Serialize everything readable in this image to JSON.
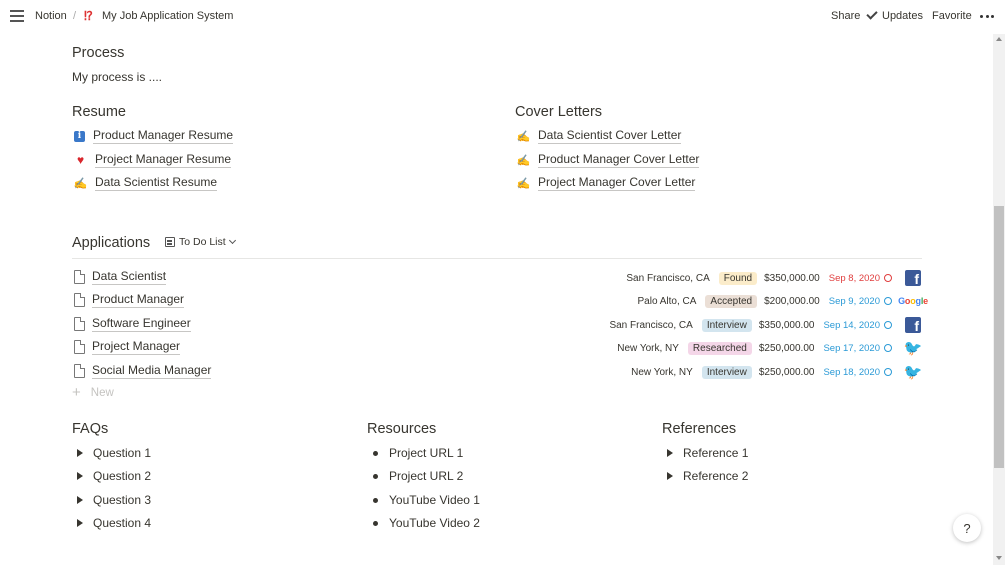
{
  "topbar": {
    "workspace": "Notion",
    "separator": "/",
    "page_icon": "⁉",
    "page_title": "My Job Application System",
    "share": "Share",
    "updates": "Updates",
    "favorite": "Favorite"
  },
  "process": {
    "heading": "Process",
    "text": "My process is ...."
  },
  "resume": {
    "heading": "Resume",
    "items": [
      {
        "icon": "info-icon",
        "label": "Product Manager Resume"
      },
      {
        "icon": "heart-icon",
        "label": "Project Manager Resume"
      },
      {
        "icon": "pencil-icon",
        "label": "Data Scientist Resume"
      }
    ]
  },
  "cover_letters": {
    "heading": "Cover Letters",
    "items": [
      {
        "icon": "pencil-icon",
        "label": "Data Scientist Cover Letter"
      },
      {
        "icon": "pencil-icon",
        "label": "Product Manager Cover Letter"
      },
      {
        "icon": "pencil-icon",
        "label": "Project Manager Cover Letter"
      }
    ]
  },
  "applications": {
    "heading": "Applications",
    "view": "To Do List",
    "new_label": "New",
    "rows": [
      {
        "title": "Data Scientist",
        "location": "San Francisco, CA",
        "status": "Found",
        "status_color": "#fbecca",
        "salary": "$350,000.00",
        "date": "Sep 8, 2020",
        "date_color": "#e03e3e",
        "company": "facebook"
      },
      {
        "title": "Product Manager",
        "location": "Palo Alto, CA",
        "status": "Accepted",
        "status_color": "#ebdfd6",
        "salary": "$200,000.00",
        "date": "Sep 9, 2020",
        "date_color": "#2b9ad6",
        "company": "google"
      },
      {
        "title": "Software Engineer",
        "location": "San Francisco, CA",
        "status": "Interview",
        "status_color": "#d3e5ef",
        "salary": "$350,000.00",
        "date": "Sep 14, 2020",
        "date_color": "#2b9ad6",
        "company": "facebook"
      },
      {
        "title": "Project Manager",
        "location": "New York, NY",
        "status": "Researched",
        "status_color": "#f4d6e8",
        "salary": "$250,000.00",
        "date": "Sep 17, 2020",
        "date_color": "#2b9ad6",
        "company": "twitter"
      },
      {
        "title": "Social Media Manager",
        "location": "New York, NY",
        "status": "Interview",
        "status_color": "#d3e5ef",
        "salary": "$250,000.00",
        "date": "Sep 18, 2020",
        "date_color": "#2b9ad6",
        "company": "twitter"
      }
    ],
    "logo_text": {
      "facebook": "f",
      "google": "Google",
      "twitter": "🐦"
    }
  },
  "faqs": {
    "heading": "FAQs",
    "items": [
      "Question 1",
      "Question 2",
      "Question 3",
      "Question 4"
    ]
  },
  "resources": {
    "heading": "Resources",
    "items": [
      "Project URL 1",
      "Project URL 2",
      "YouTube Video 1",
      "YouTube Video 2"
    ]
  },
  "references": {
    "heading": "References",
    "items": [
      "Reference 1",
      "Reference 2"
    ]
  },
  "help": "?"
}
